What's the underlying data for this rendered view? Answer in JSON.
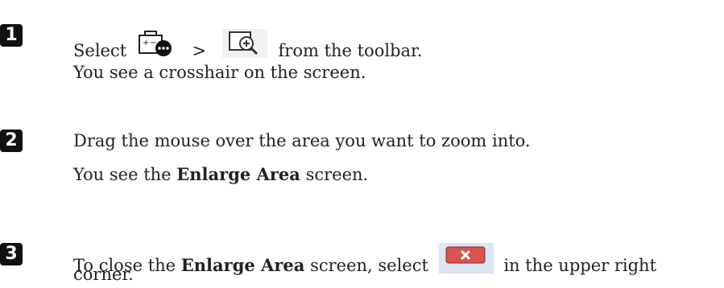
{
  "steps": [
    {
      "number": "1",
      "line1": {
        "before": "Select",
        "separator": ">",
        "after": "from the toolbar."
      },
      "line2": "You see a crosshair on the screen.",
      "icons": [
        "toolbox-icon",
        "zoom-area-icon"
      ]
    },
    {
      "number": "2",
      "line1": "Drag the mouse over the area you want to zoom into.",
      "line2": {
        "before": "You see the",
        "bold": "Enlarge Area",
        "after": "screen."
      }
    },
    {
      "number": "3",
      "line1": {
        "before": "To close the",
        "bold": "Enlarge Area",
        "middle": "screen, select",
        "after": "in the upper right"
      },
      "line2": "corner.",
      "icons": [
        "close-window-icon"
      ]
    }
  ],
  "colors": {
    "badge": "#111111",
    "text": "#222222",
    "close_button": "#d9534f"
  }
}
